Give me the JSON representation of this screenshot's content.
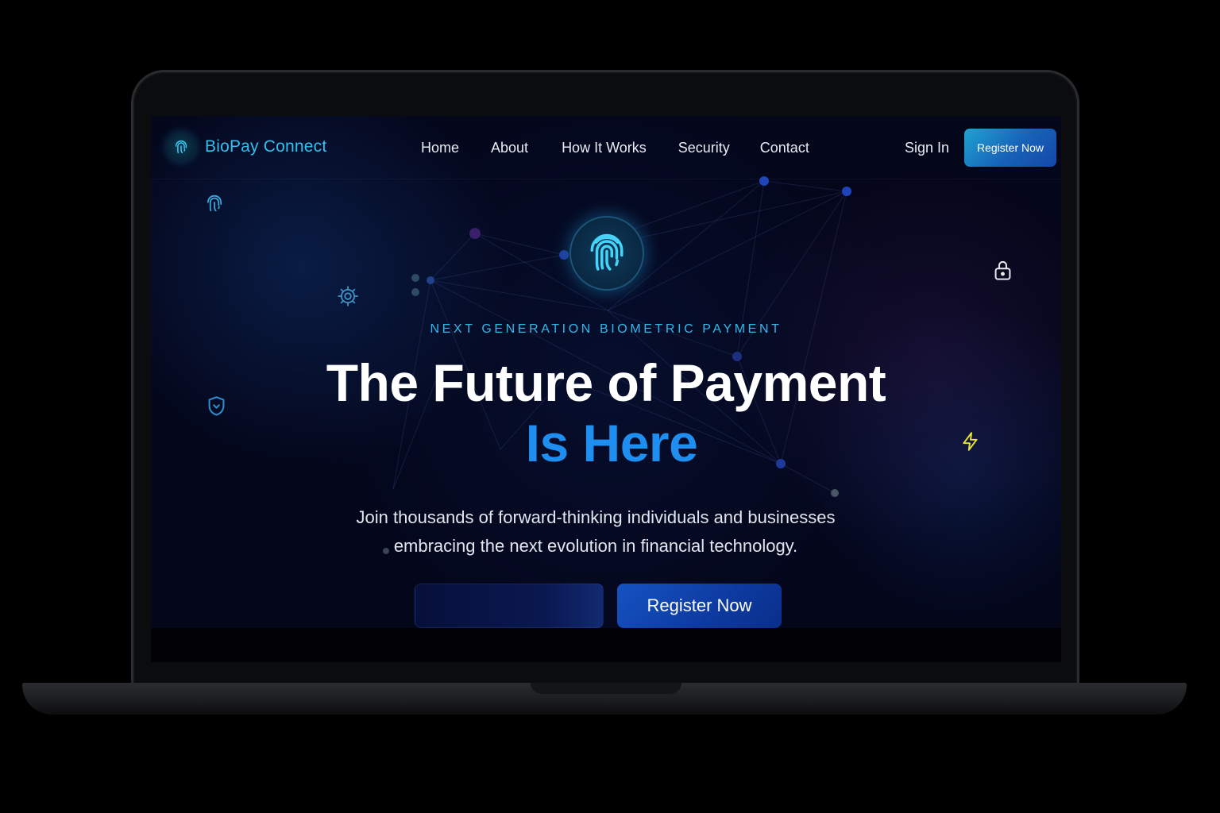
{
  "brand": {
    "name": "BioPay Connect",
    "logo_icon": "fingerprint-icon",
    "color": "#2fc0ee"
  },
  "nav": {
    "links": [
      "Home",
      "About",
      "How It Works",
      "Security",
      "Contact"
    ],
    "sign_in": "Sign In",
    "cta": "Register Now"
  },
  "hero": {
    "badge_icon": "fingerprint-icon",
    "eyebrow": "NEXT GENERATION BIOMETRIC PAYMENT",
    "headline_line1": "The Future of Payment",
    "headline_line2": "Is Here",
    "subtext_line1": "Join thousands of forward-thinking individuals and businesses",
    "subtext_line2": "embracing the next evolution in financial technology.",
    "primary_button": "Register Now",
    "secondary_button": ""
  },
  "floating_icons": [
    "fingerprint-icon",
    "gear-icon",
    "shield-icon",
    "lock-icon",
    "lightning-icon"
  ],
  "colors": {
    "accent": "#1e8ff0",
    "eyebrow": "#2fb9ea",
    "background": "#04061a",
    "lightning": "#e8e23a"
  }
}
